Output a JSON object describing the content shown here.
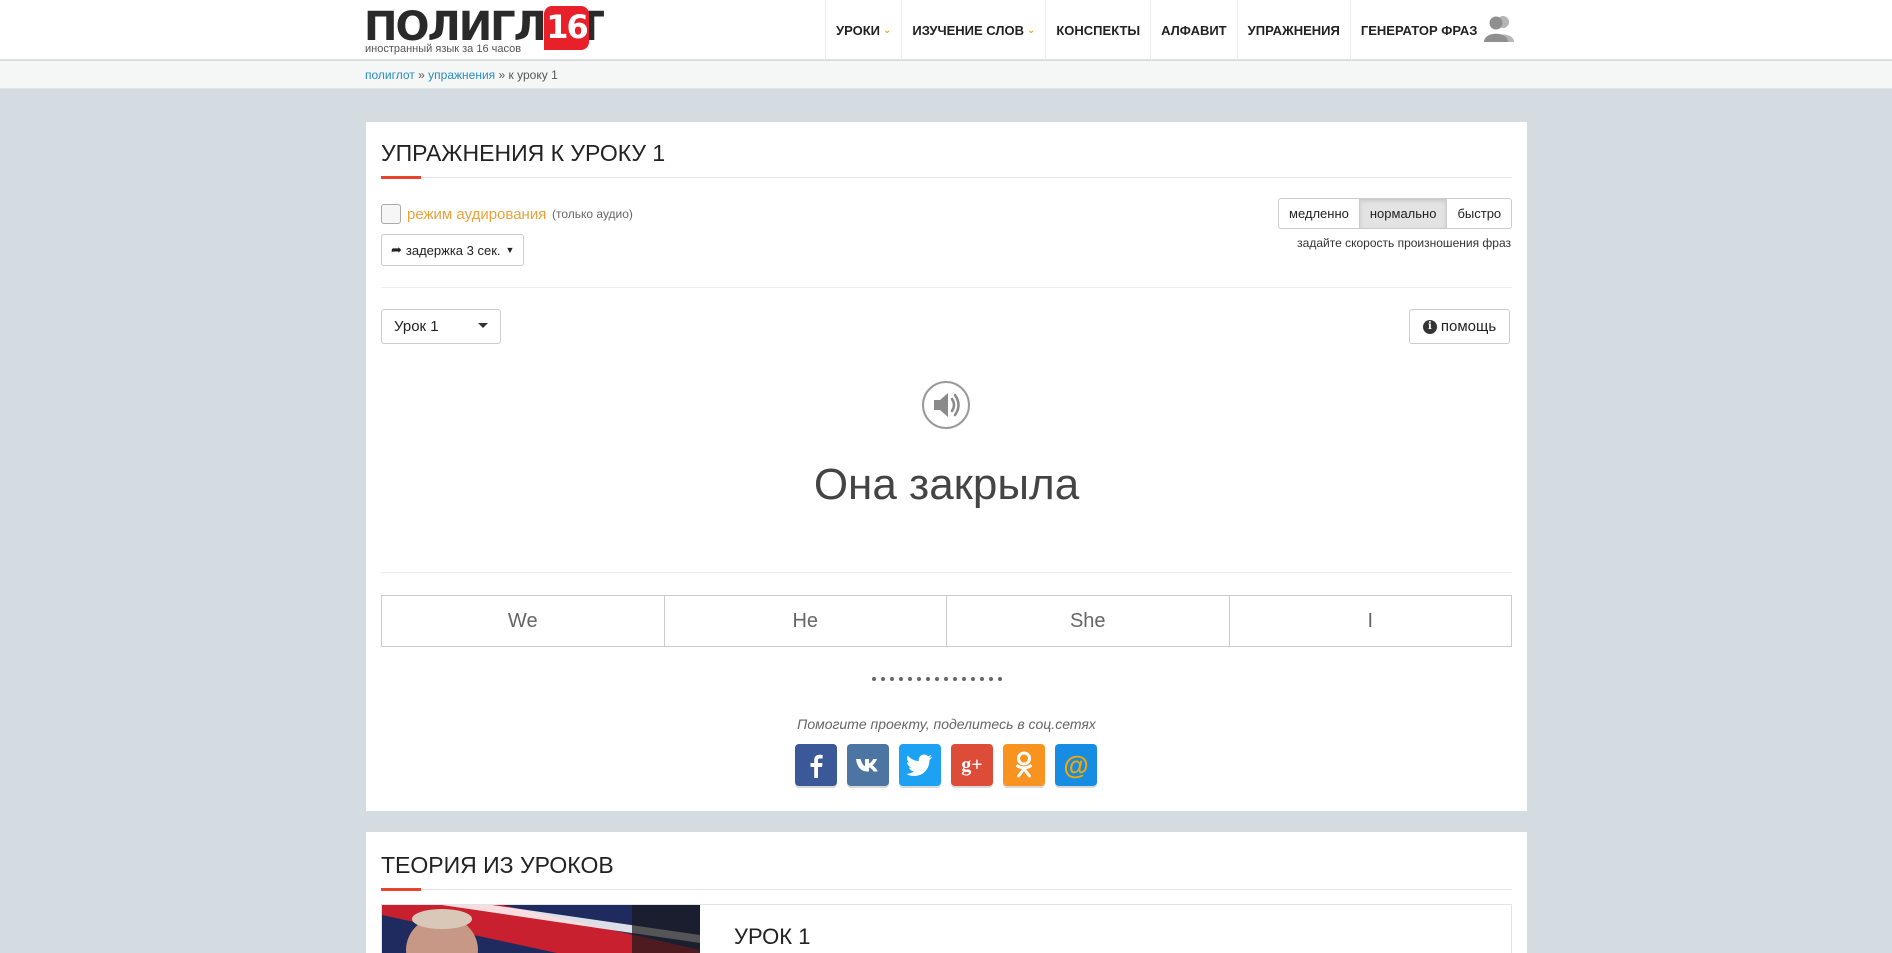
{
  "header": {
    "logo_text": "ПОЛИГЛОТ",
    "logo_number": "16",
    "logo_subtitle": "иностранный язык за 16 часов",
    "nav": [
      {
        "label": "УРОКИ",
        "has_caret": true
      },
      {
        "label": "ИЗУЧЕНИЕ СЛОВ",
        "has_caret": true
      },
      {
        "label": "КОНСПЕКТЫ",
        "has_caret": false
      },
      {
        "label": "АЛФАВИТ",
        "has_caret": false
      },
      {
        "label": "УПРАЖНЕНИЯ",
        "has_caret": false
      },
      {
        "label": "ГЕНЕРАТОР ФРАЗ",
        "has_caret": false
      }
    ],
    "caret_symbol": "⌄"
  },
  "breadcrumb": {
    "items": [
      "полиглот",
      "упражнения",
      "к уроку 1"
    ],
    "separator": "»"
  },
  "exercise": {
    "title": "УПРАЖНЕНИЯ К УРОКУ 1",
    "audio_mode_label": "режим аудирования",
    "audio_only_note": "(только аудио)",
    "audio_mode_checked": false,
    "delay_label": "задержка 3 сек.",
    "speed_options": [
      "медленно",
      "нормально",
      "быстро"
    ],
    "speed_selected": "нормально",
    "speed_hint": "задайте скорость произношения фраз",
    "lesson_select_value": "Урок 1",
    "help_label": "помощь",
    "phrase": "Она закрыла",
    "answers": [
      "We",
      "He",
      "She",
      "I"
    ],
    "progress_dots": 15,
    "share_text": "Помогите проекту, поделитесь в соц.сетях",
    "social": [
      {
        "icon": "facebook-icon",
        "glyph": "f",
        "color": "#3b5998"
      },
      {
        "icon": "vk-icon",
        "glyph": "vk",
        "color": "#4c75a3"
      },
      {
        "icon": "twitter-icon",
        "glyph": "t",
        "color": "#1da1f2"
      },
      {
        "icon": "google-plus-icon",
        "glyph": "g+",
        "color": "#dd4b39"
      },
      {
        "icon": "odnoklassniki-icon",
        "glyph": "ok",
        "color": "#f7931e"
      },
      {
        "icon": "mail-ru-icon",
        "glyph": "@",
        "color": "#168de2"
      }
    ]
  },
  "theory": {
    "title": "ТЕОРИЯ ИЗ УРОКОВ",
    "lesson_title": "УРОК 1"
  },
  "colors": {
    "accent_red": "#e8432c",
    "link_blue": "#2a8cc6",
    "audio_orange": "#e8a23a",
    "page_bg": "#d4dbe1"
  }
}
